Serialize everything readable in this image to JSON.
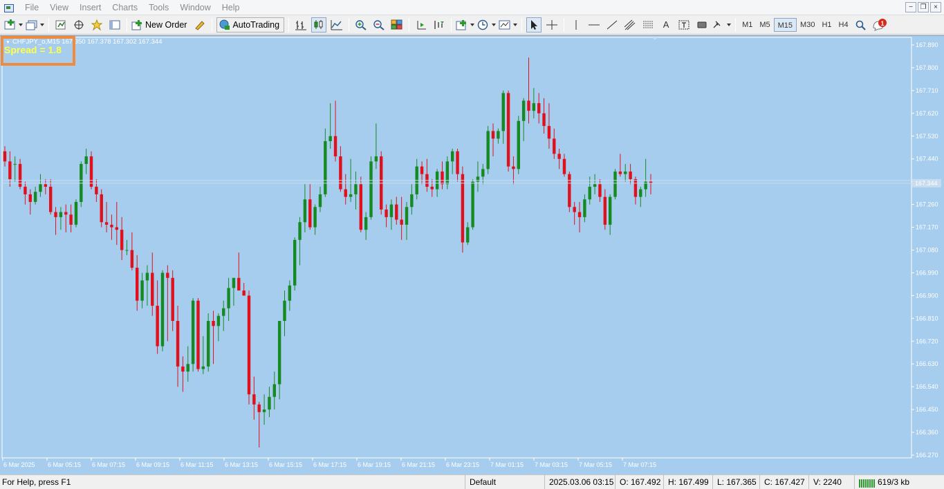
{
  "menu": [
    "File",
    "View",
    "Insert",
    "Charts",
    "Tools",
    "Window",
    "Help"
  ],
  "window_controls": [
    "−",
    "❐",
    "×"
  ],
  "toolbar": {
    "new_order_label": "New Order",
    "autotrading_label": "AutoTrading",
    "timeframes": [
      "M1",
      "M5",
      "M15",
      "M30",
      "H1",
      "H4"
    ],
    "active_timeframe": "M15",
    "notification_count": "1"
  },
  "chart": {
    "header_text": "CHFJPY_o,M15  167.350 167.378 167.302 167.344",
    "spread_label": "Spread = 1.8",
    "current_price": "167.344",
    "colors": {
      "background": "#a6cdee",
      "bull": "#168a22",
      "bear": "#e0101c",
      "axis_text": "#ffffff"
    }
  },
  "chart_data": {
    "type": "candlestick",
    "symbol": "CHFJPY_o",
    "timeframe": "M15",
    "y_ticks": [
      167.89,
      167.8,
      167.71,
      167.62,
      167.53,
      167.44,
      167.35,
      167.26,
      167.17,
      167.08,
      166.99,
      166.9,
      166.81,
      166.72,
      166.63,
      166.54,
      166.45,
      166.36,
      166.27
    ],
    "ylim": [
      166.27,
      167.89
    ],
    "x_tick_labels": [
      "6 Mar 2025",
      "6 Mar 05:15",
      "6 Mar 07:15",
      "6 Mar 09:15",
      "6 Mar 11:15",
      "6 Mar 13:15",
      "6 Mar 15:15",
      "6 Mar 17:15",
      "6 Mar 19:15",
      "6 Mar 21:15",
      "6 Mar 23:15",
      "7 Mar 01:15",
      "7 Mar 03:15",
      "7 Mar 05:15",
      "7 Mar 07:15"
    ],
    "candles": [
      [
        167.47,
        167.49,
        167.41,
        167.43
      ],
      [
        167.43,
        167.47,
        167.33,
        167.36
      ],
      [
        167.42,
        167.45,
        167.35,
        167.42
      ],
      [
        167.42,
        167.44,
        167.32,
        167.33
      ],
      [
        167.33,
        167.35,
        167.26,
        167.3
      ],
      [
        167.3,
        167.32,
        167.22,
        167.27
      ],
      [
        167.27,
        167.33,
        167.26,
        167.31
      ],
      [
        167.31,
        167.38,
        167.29,
        167.34
      ],
      [
        167.34,
        167.36,
        167.3,
        167.33
      ],
      [
        167.33,
        167.36,
        167.22,
        167.23
      ],
      [
        167.23,
        167.25,
        167.14,
        167.21
      ],
      [
        167.21,
        167.25,
        167.16,
        167.23
      ],
      [
        167.23,
        167.26,
        167.15,
        167.22
      ],
      [
        167.22,
        167.26,
        167.15,
        167.18
      ],
      [
        167.18,
        167.28,
        167.17,
        167.27
      ],
      [
        167.27,
        167.43,
        167.25,
        167.42
      ],
      [
        167.42,
        167.48,
        167.38,
        167.45
      ],
      [
        167.45,
        167.47,
        167.32,
        167.33
      ],
      [
        167.33,
        167.36,
        167.27,
        167.3
      ],
      [
        167.3,
        167.32,
        167.17,
        167.19
      ],
      [
        167.19,
        167.27,
        167.15,
        167.18
      ],
      [
        167.18,
        167.22,
        167.12,
        167.17
      ],
      [
        167.17,
        167.27,
        167.1,
        167.16
      ],
      [
        167.16,
        167.21,
        167.04,
        167.08
      ],
      [
        167.08,
        167.12,
        167.06,
        167.08
      ],
      [
        167.08,
        167.15,
        167.0,
        167.01
      ],
      [
        167.01,
        167.06,
        166.84,
        166.88
      ],
      [
        166.88,
        166.99,
        166.85,
        166.96
      ],
      [
        166.96,
        167.02,
        166.86,
        166.99
      ],
      [
        166.99,
        167.07,
        166.82,
        166.86
      ],
      [
        166.86,
        166.96,
        166.67,
        166.7
      ],
      [
        166.7,
        167.0,
        166.68,
        166.99
      ],
      [
        166.99,
        167.02,
        166.72,
        166.97
      ],
      [
        166.97,
        167.0,
        166.76,
        166.8
      ],
      [
        166.8,
        166.86,
        166.54,
        166.62
      ],
      [
        166.62,
        166.66,
        166.52,
        166.6
      ],
      [
        166.6,
        166.7,
        166.56,
        166.63
      ],
      [
        166.63,
        166.89,
        166.6,
        166.88
      ],
      [
        166.88,
        166.89,
        166.6,
        166.61
      ],
      [
        166.61,
        166.74,
        166.59,
        166.62
      ],
      [
        166.62,
        166.83,
        166.6,
        166.8
      ],
      [
        166.8,
        166.84,
        166.63,
        166.78
      ],
      [
        166.78,
        166.83,
        166.72,
        166.82
      ],
      [
        166.82,
        166.88,
        166.76,
        166.85
      ],
      [
        166.85,
        166.97,
        166.8,
        166.93
      ],
      [
        166.93,
        166.97,
        166.86,
        166.97
      ],
      [
        166.97,
        167.07,
        166.95,
        166.92
      ],
      [
        166.92,
        166.95,
        166.9,
        166.9
      ],
      [
        166.9,
        166.92,
        166.47,
        166.51
      ],
      [
        166.51,
        166.58,
        166.41,
        166.47
      ],
      [
        166.47,
        166.48,
        166.3,
        166.44
      ],
      [
        166.44,
        166.51,
        166.39,
        166.45
      ],
      [
        166.45,
        166.54,
        166.42,
        166.5
      ],
      [
        166.5,
        166.6,
        166.45,
        166.55
      ],
      [
        166.55,
        166.79,
        166.49,
        166.8
      ],
      [
        166.8,
        166.92,
        166.74,
        166.88
      ],
      [
        166.88,
        166.96,
        166.84,
        166.94
      ],
      [
        166.94,
        167.13,
        166.92,
        167.12
      ],
      [
        167.12,
        167.21,
        167.02,
        167.19
      ],
      [
        167.19,
        167.34,
        167.15,
        167.28
      ],
      [
        167.28,
        167.34,
        167.16,
        167.17
      ],
      [
        167.17,
        167.26,
        167.14,
        167.25
      ],
      [
        167.25,
        167.33,
        167.23,
        167.3
      ],
      [
        167.3,
        167.56,
        167.29,
        167.51
      ],
      [
        167.51,
        167.66,
        167.48,
        167.53
      ],
      [
        167.53,
        167.67,
        167.43,
        167.45
      ],
      [
        167.45,
        167.49,
        167.31,
        167.32
      ],
      [
        167.32,
        167.38,
        167.26,
        167.29
      ],
      [
        167.29,
        167.44,
        167.27,
        167.3
      ],
      [
        167.3,
        167.39,
        167.24,
        167.34
      ],
      [
        167.34,
        167.37,
        167.15,
        167.16
      ],
      [
        167.16,
        167.23,
        167.12,
        167.21
      ],
      [
        167.21,
        167.45,
        167.2,
        167.43
      ],
      [
        167.43,
        167.58,
        167.4,
        167.45
      ],
      [
        167.45,
        167.47,
        167.22,
        167.24
      ],
      [
        167.24,
        167.26,
        167.17,
        167.21
      ],
      [
        167.21,
        167.28,
        167.16,
        167.26
      ],
      [
        167.26,
        167.29,
        167.18,
        167.2
      ],
      [
        167.2,
        167.29,
        167.12,
        167.18
      ],
      [
        167.18,
        167.27,
        167.12,
        167.25
      ],
      [
        167.25,
        167.34,
        167.22,
        167.3
      ],
      [
        167.3,
        167.44,
        167.28,
        167.41
      ],
      [
        167.41,
        167.43,
        167.34,
        167.38
      ],
      [
        167.38,
        167.44,
        167.31,
        167.33
      ],
      [
        167.33,
        167.36,
        167.29,
        167.32
      ],
      [
        167.32,
        167.4,
        167.29,
        167.39
      ],
      [
        167.39,
        167.43,
        167.32,
        167.34
      ],
      [
        167.34,
        167.45,
        167.32,
        167.43
      ],
      [
        167.43,
        167.48,
        167.38,
        167.47
      ],
      [
        167.47,
        167.48,
        167.35,
        167.38
      ],
      [
        167.38,
        167.41,
        167.07,
        167.11
      ],
      [
        167.11,
        167.19,
        167.1,
        167.17
      ],
      [
        167.17,
        167.36,
        167.16,
        167.35
      ],
      [
        167.35,
        167.43,
        167.31,
        167.37
      ],
      [
        167.37,
        167.42,
        167.34,
        167.4
      ],
      [
        167.4,
        167.57,
        167.38,
        167.55
      ],
      [
        167.55,
        167.58,
        167.45,
        167.52
      ],
      [
        167.52,
        167.56,
        167.5,
        167.55
      ],
      [
        167.55,
        167.71,
        167.5,
        167.7
      ],
      [
        167.7,
        167.71,
        167.39,
        167.41
      ],
      [
        167.41,
        167.45,
        167.34,
        167.4
      ],
      [
        167.4,
        167.61,
        167.38,
        167.59
      ],
      [
        167.59,
        167.68,
        167.51,
        167.67
      ],
      [
        167.67,
        167.84,
        167.58,
        167.63
      ],
      [
        167.63,
        167.72,
        167.6,
        167.66
      ],
      [
        167.66,
        167.7,
        167.58,
        167.62
      ],
      [
        167.62,
        167.68,
        167.54,
        167.57
      ],
      [
        167.57,
        167.66,
        167.48,
        167.52
      ],
      [
        167.52,
        167.56,
        167.44,
        167.46
      ],
      [
        167.46,
        167.48,
        167.4,
        167.44
      ],
      [
        167.44,
        167.46,
        167.37,
        167.38
      ],
      [
        167.38,
        167.39,
        167.23,
        167.25
      ],
      [
        167.25,
        167.27,
        167.18,
        167.23
      ],
      [
        167.23,
        167.27,
        167.15,
        167.21
      ],
      [
        167.21,
        167.3,
        167.19,
        167.28
      ],
      [
        167.28,
        167.37,
        167.26,
        167.33
      ],
      [
        167.33,
        167.38,
        167.3,
        167.34
      ],
      [
        167.34,
        167.36,
        167.27,
        167.29
      ],
      [
        167.29,
        167.32,
        167.16,
        167.18
      ],
      [
        167.18,
        167.3,
        167.14,
        167.29
      ],
      [
        167.29,
        167.4,
        167.28,
        167.39
      ],
      [
        167.39,
        167.46,
        167.37,
        167.38
      ],
      [
        167.38,
        167.42,
        167.35,
        167.39
      ],
      [
        167.39,
        167.42,
        167.34,
        167.36
      ],
      [
        167.36,
        167.37,
        167.26,
        167.29
      ],
      [
        167.29,
        167.33,
        167.25,
        167.32
      ],
      [
        167.32,
        167.44,
        167.29,
        167.35
      ],
      [
        167.35,
        167.38,
        167.3,
        167.344
      ]
    ]
  },
  "status": {
    "help_text": "For Help, press F1",
    "profile": "Default",
    "datetime": "2025.03.06 03:15",
    "open": "O: 167.492",
    "high": "H: 167.499",
    "low": "L: 167.365",
    "close": "C: 167.427",
    "volume": "V: 2240",
    "connection": "619/3 kb"
  }
}
